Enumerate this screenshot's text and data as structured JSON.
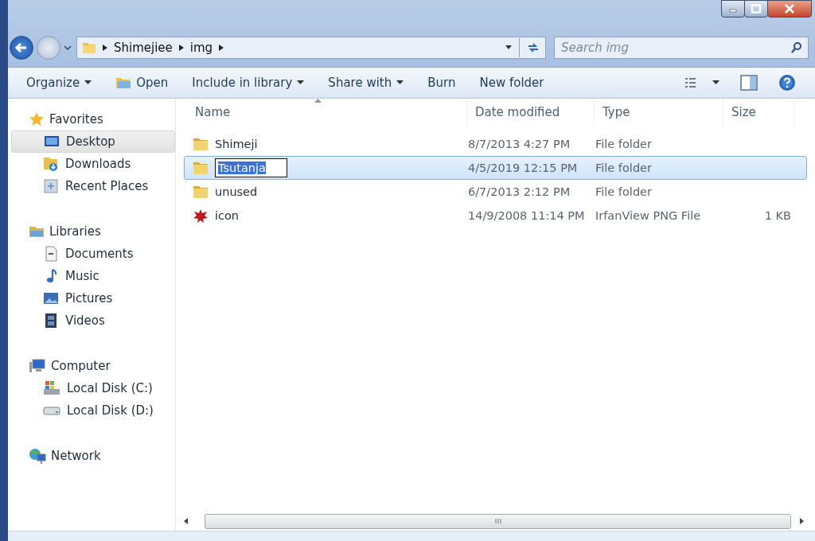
{
  "address": {
    "crumbs": [
      "Shimejiee",
      "img"
    ]
  },
  "search": {
    "placeholder": "Search img"
  },
  "toolbar": [
    {
      "label": "Organize",
      "dropdown": true,
      "kind": "menu"
    },
    {
      "label": "Open",
      "dropdown": false,
      "kind": "open"
    },
    {
      "label": "Include in library",
      "dropdown": true,
      "kind": "menu"
    },
    {
      "label": "Share with",
      "dropdown": true,
      "kind": "menu"
    },
    {
      "label": "Burn",
      "dropdown": false,
      "kind": "menu"
    },
    {
      "label": "New folder",
      "dropdown": false,
      "kind": "menu"
    }
  ],
  "sidebar": [
    {
      "label": "Favorites",
      "kind": "favorites",
      "items": [
        {
          "label": "Desktop",
          "selected": true
        },
        {
          "label": "Downloads",
          "selected": false
        },
        {
          "label": "Recent Places",
          "selected": false
        }
      ]
    },
    {
      "label": "Libraries",
      "kind": "libraries",
      "items": [
        {
          "label": "Documents",
          "selected": false
        },
        {
          "label": "Music",
          "selected": false
        },
        {
          "label": "Pictures",
          "selected": false
        },
        {
          "label": "Videos",
          "selected": false
        }
      ]
    },
    {
      "label": "Computer",
      "kind": "computer",
      "items": [
        {
          "label": "Local Disk (C:)",
          "selected": false
        },
        {
          "label": "Local Disk (D:)",
          "selected": false
        }
      ]
    },
    {
      "label": "Network",
      "kind": "network"
    }
  ],
  "table": {
    "columns": [
      "Name",
      "Date modified",
      "Type",
      "Size"
    ],
    "rows": [
      {
        "kind": "folder",
        "name": "Shimeji",
        "date": "8/7/2013 4:27 PM",
        "type": "File folder",
        "selected": false,
        "editing": false
      },
      {
        "kind": "folder",
        "name": "Tsutanja",
        "date": "4/5/2019 12:15 PM",
        "type": "File folder",
        "selected": true,
        "editing": true
      },
      {
        "kind": "folder",
        "name": "unused",
        "date": "6/7/2013 2:12 PM",
        "type": "File folder",
        "selected": false,
        "editing": false
      },
      {
        "kind": "image",
        "name": "icon",
        "date": "14/9/2008 11:14 PM",
        "type": "IrfanView PNG File",
        "size": "1 KB",
        "selected": false,
        "editing": false
      }
    ]
  }
}
